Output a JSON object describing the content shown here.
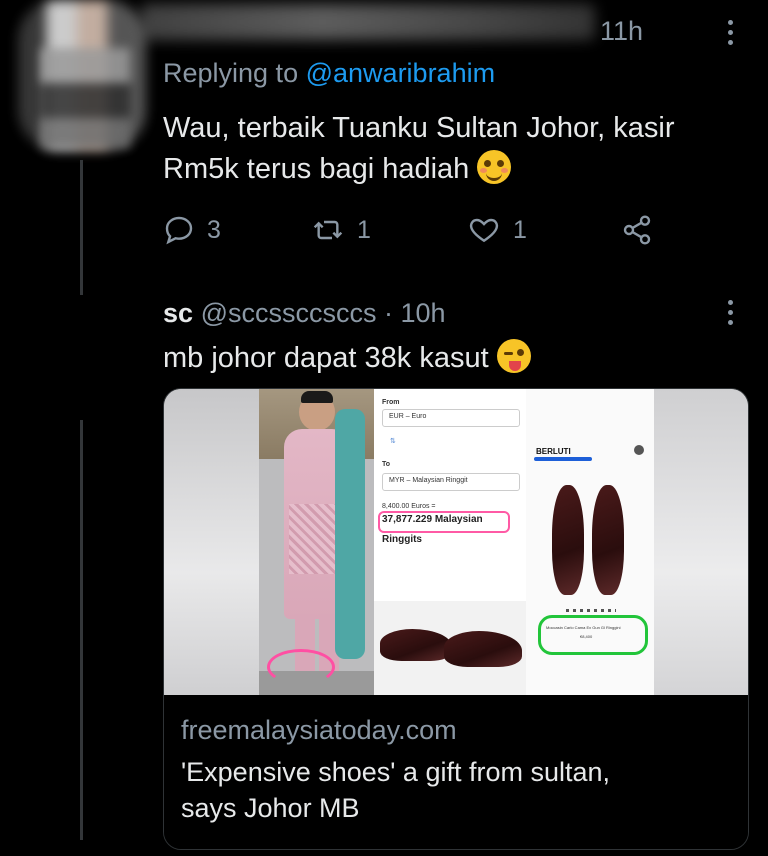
{
  "tweet1": {
    "time": "11h",
    "replying_prefix": "Replying to",
    "replying_handle": "@anwaribrahim",
    "body_line1": "Wau, terbaik Tuanku Sultan Johor, kasir",
    "body_line2": "Rm5k terus bagi hadiah",
    "emoji": "smiling-face-with-hearts-emoji",
    "replies": "3",
    "retweets": "1",
    "likes": "1"
  },
  "tweet2": {
    "name": "sc",
    "handle": "@sccssccsccs",
    "separator": "·",
    "time": "10h",
    "body": "mb johor dapat 38k kasut",
    "emoji": "winking-face-with-tongue-emoji",
    "card": {
      "domain": "freemalaysiatoday.com",
      "title_line1": "'Expensive shoes' a gift from sultan,",
      "title_line2": "says Johor MB",
      "image": {
        "from_label": "From",
        "from_currency": "EUR – Euro",
        "to_label": "To",
        "to_currency": "MYR – Malaysian Ringgit",
        "from_amount": "8,400.00 Euros =",
        "result_amount": "37,877.229 Malaysian",
        "result_unit": "Ringgits",
        "brand": "BERLUTI",
        "product_name": "Moccasin Carlo Cama Ex Gun Gl Ringgini",
        "product_price": "€8,400"
      }
    }
  },
  "colors": {
    "background": "#000000",
    "text": "#e7e9ea",
    "muted": "#8b98a5",
    "accent": "#1d9bf0",
    "thread_line": "#333639",
    "card_border": "#2f3336"
  }
}
